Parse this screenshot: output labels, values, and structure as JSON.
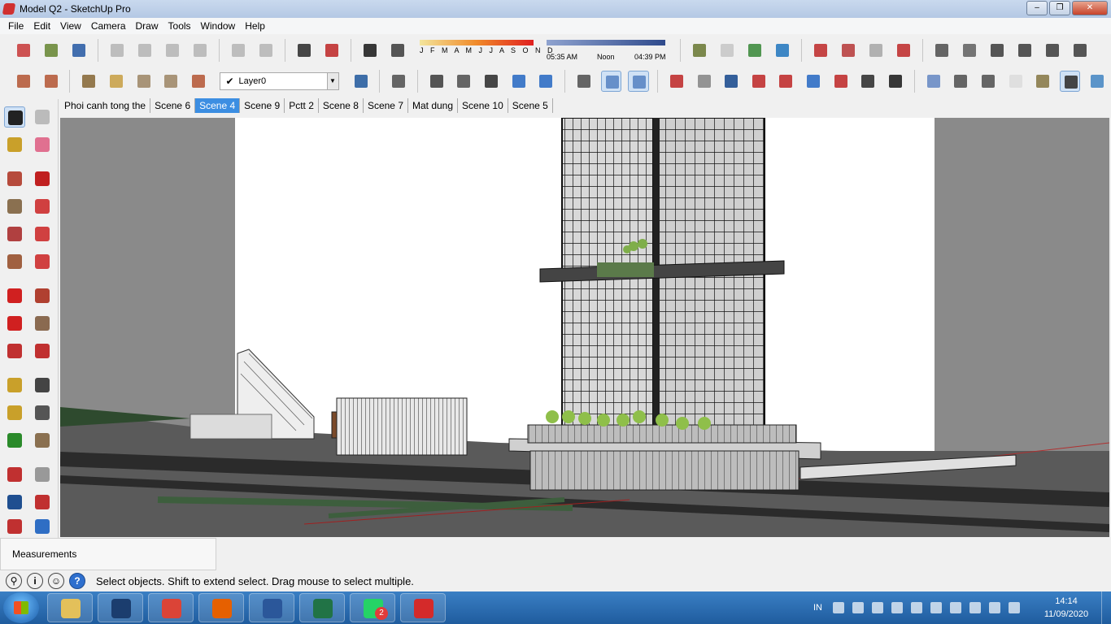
{
  "window": {
    "title": "Model Q2 - SketchUp Pro",
    "controls": [
      "minimize",
      "maximize",
      "close"
    ]
  },
  "menu": [
    "File",
    "Edit",
    "View",
    "Camera",
    "Draw",
    "Tools",
    "Window",
    "Help"
  ],
  "shadow_settings": {
    "months": "J F M A M J J A S O N D",
    "time_start": "05:35 AM",
    "time_noon": "Noon",
    "time_end": "04:39 PM"
  },
  "layer": {
    "current": "Layer0"
  },
  "scene_tabs": [
    {
      "label": "Phoi canh tong the",
      "active": false
    },
    {
      "label": "Scene 6",
      "active": false
    },
    {
      "label": "Scene 4",
      "active": true
    },
    {
      "label": "Scene 9",
      "active": false
    },
    {
      "label": "Pctt 2",
      "active": false
    },
    {
      "label": "Scene 8",
      "active": false
    },
    {
      "label": "Scene 7",
      "active": false
    },
    {
      "label": "Mat dung",
      "active": false
    },
    {
      "label": "Scene 10",
      "active": false
    },
    {
      "label": "Scene 5",
      "active": false
    }
  ],
  "measurements": {
    "label": "Measurements"
  },
  "status": {
    "message": "Select objects. Shift to extend select. Drag mouse to select multiple."
  },
  "taskbar": {
    "apps": [
      "file-explorer",
      "photoshop",
      "chrome",
      "firefox",
      "word",
      "excel",
      "whatsapp",
      "sketchup"
    ],
    "whatsapp_badge": "2",
    "language": "IN",
    "time": "14:14",
    "date": "11/09/2020"
  },
  "colors": {
    "titlebar": "#b4c8e4",
    "active_tab": "#3c8ee2",
    "taskbar": "#1f5c9e",
    "viewport_bg": "#ffffff"
  }
}
